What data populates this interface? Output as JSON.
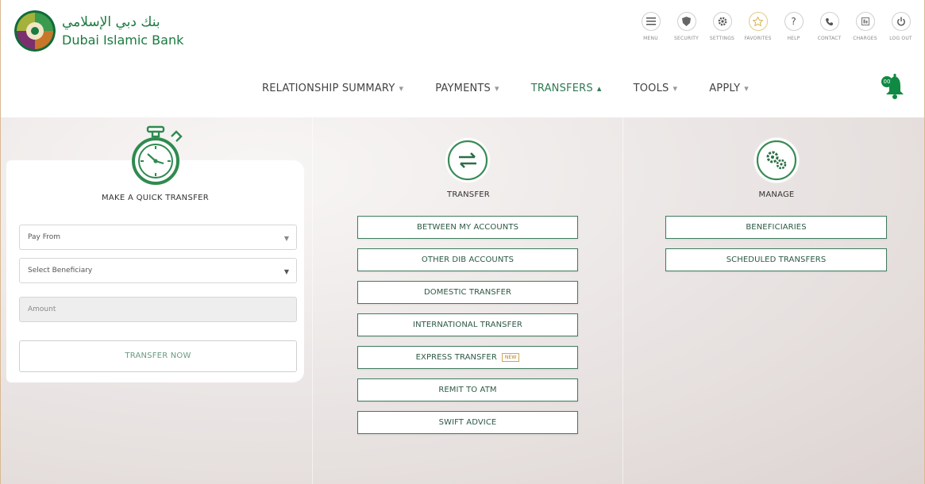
{
  "brand": {
    "arabic": "بنك دبي الإسلامي",
    "english": "Dubai Islamic Bank"
  },
  "toolbar": [
    {
      "label": "MENU",
      "icon": "menu-icon"
    },
    {
      "label": "SECURITY",
      "icon": "shield-icon"
    },
    {
      "label": "SETTINGS",
      "icon": "gear-icon"
    },
    {
      "label": "FAVORITES",
      "icon": "star-icon"
    },
    {
      "label": "HELP",
      "icon": "help-icon"
    },
    {
      "label": "CONTACT",
      "icon": "phone-icon"
    },
    {
      "label": "CHARGES",
      "icon": "charges-icon"
    },
    {
      "label": "LOG OUT",
      "icon": "power-icon"
    }
  ],
  "nav": [
    {
      "label": "RELATIONSHIP SUMMARY"
    },
    {
      "label": "PAYMENTS"
    },
    {
      "label": "TRANSFERS",
      "active": true
    },
    {
      "label": "TOOLS"
    },
    {
      "label": "APPLY"
    }
  ],
  "notifications": {
    "badge": "00"
  },
  "quick_transfer": {
    "title": "MAKE A QUICK TRANSFER",
    "pay_from": "Pay From",
    "beneficiary": "Select Beneficiary",
    "amount_placeholder": "Amount",
    "submit": "TRANSFER NOW"
  },
  "transfer": {
    "title": "TRANSFER",
    "buttons": [
      "BETWEEN MY ACCOUNTS",
      "OTHER DIB ACCOUNTS",
      "DOMESTIC TRANSFER",
      "INTERNATIONAL TRANSFER",
      "EXPRESS TRANSFER",
      "REMIT TO ATM",
      "SWIFT ADVICE"
    ],
    "new_tag": "NEW"
  },
  "manage": {
    "title": "MANAGE",
    "buttons": [
      "BENEFICIARIES",
      "SCHEDULED TRANSFERS"
    ]
  },
  "colors": {
    "brand_green": "#1a7a3f",
    "button_border": "#3f7b5e",
    "active_nav": "#2e7a54"
  }
}
